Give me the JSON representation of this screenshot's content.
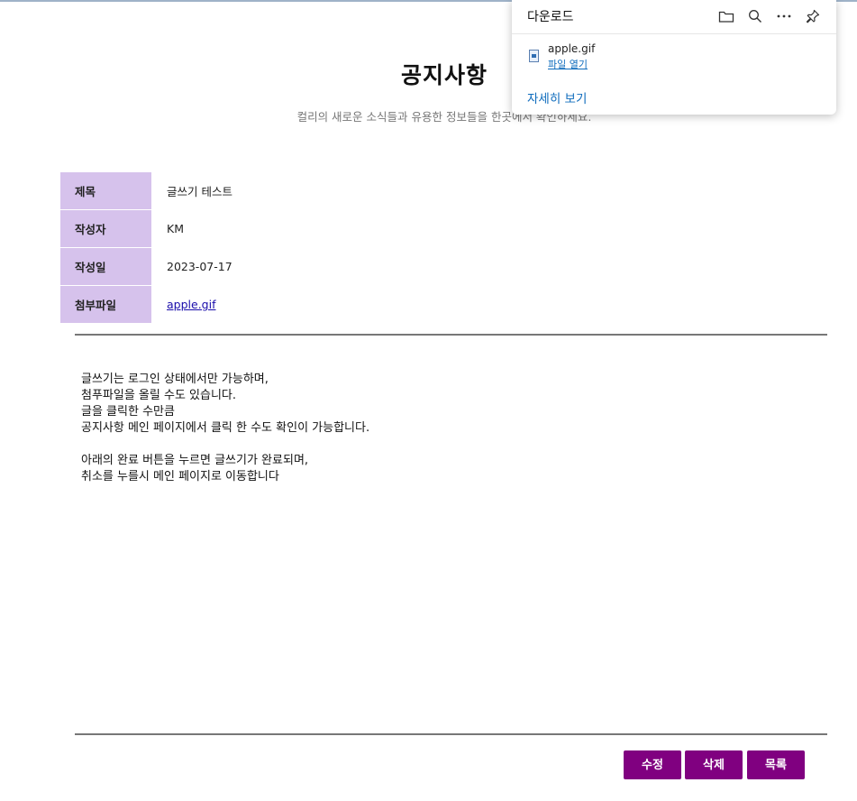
{
  "page": {
    "title": "공지사항",
    "subtitle": "컬리의 새로운 소식들과 유용한 정보들을 한곳에서 확인하세요."
  },
  "post": {
    "fields": [
      {
        "label": "제목",
        "value": "글쓰기 테스트"
      },
      {
        "label": "작성자",
        "value": "KM"
      },
      {
        "label": "작성일",
        "value": "2023-07-17"
      },
      {
        "label": "첨부파일",
        "value": "apple.gif"
      }
    ],
    "body": [
      "글쓰기는 로그인 상태에서만 가능하며,",
      "첨푸파일을 올릴 수도 있습니다.",
      "글을 클릭한 수만큼",
      "공지사항 메인 페이지에서 클릭 한 수도 확인이 가능합니다.",
      "",
      "아래의 완료 버튼을 누르면 글쓰기가 완료되며,",
      "취소를 누를시 메인 페이지로 이동합니다"
    ]
  },
  "actions": {
    "edit_label": "수정",
    "delete_label": "삭제",
    "list_label": "목록"
  },
  "colors": {
    "label_bg": "#d6c2ec",
    "button_bg": "#800080",
    "link": "#0f6cbd"
  },
  "downloads": {
    "title": "다운로드",
    "icons": [
      "folder-icon",
      "search-icon",
      "more-icon",
      "pin-icon"
    ],
    "item": {
      "filename": "apple.gif",
      "action": "파일 열기"
    },
    "see_more": "자세히 보기"
  }
}
